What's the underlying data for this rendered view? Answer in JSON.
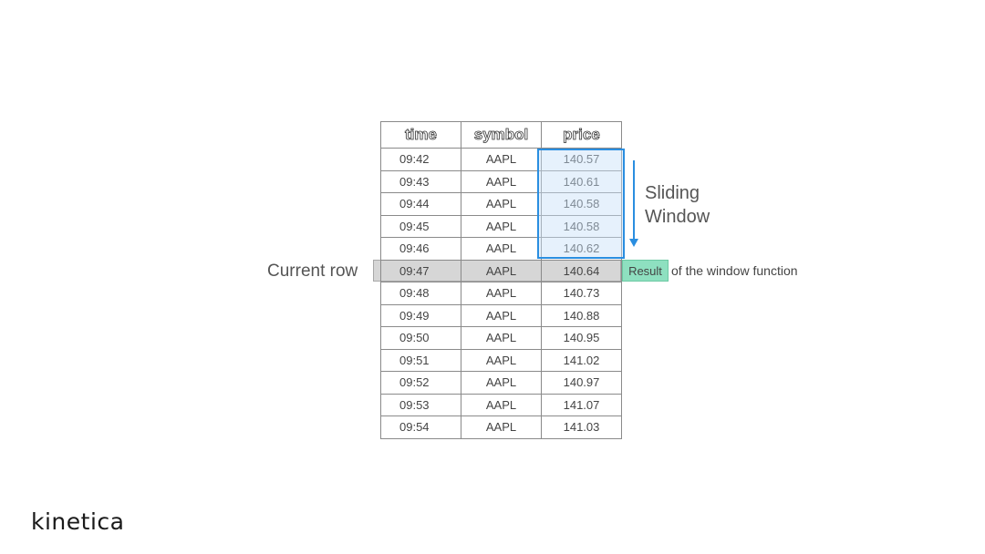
{
  "table": {
    "headers": [
      "time",
      "symbol",
      "price"
    ],
    "rows": [
      [
        "09:42",
        "AAPL",
        "140.57"
      ],
      [
        "09:43",
        "AAPL",
        "140.61"
      ],
      [
        "09:44",
        "AAPL",
        "140.58"
      ],
      [
        "09:45",
        "AAPL",
        "140.58"
      ],
      [
        "09:46",
        "AAPL",
        "140.62"
      ],
      [
        "09:47",
        "AAPL",
        "140.64"
      ],
      [
        "09:48",
        "AAPL",
        "140.73"
      ],
      [
        "09:49",
        "AAPL",
        "140.88"
      ],
      [
        "09:50",
        "AAPL",
        "140.95"
      ],
      [
        "09:51",
        "AAPL",
        "141.02"
      ],
      [
        "09:52",
        "AAPL",
        "140.97"
      ],
      [
        "09:53",
        "AAPL",
        "141.07"
      ],
      [
        "09:54",
        "AAPL",
        "141.03"
      ]
    ]
  },
  "annotations": {
    "current_row": "Current row",
    "sliding_window_line1": "Sliding",
    "sliding_window_line2": "Window",
    "result": "Result",
    "result_tail": "of the window function"
  },
  "colors": {
    "window_border": "#2a8ee0",
    "result_fill": "#8ee0c0",
    "current_row_fill": "#d6d6d6"
  },
  "logo": {
    "text": "kinetica"
  }
}
